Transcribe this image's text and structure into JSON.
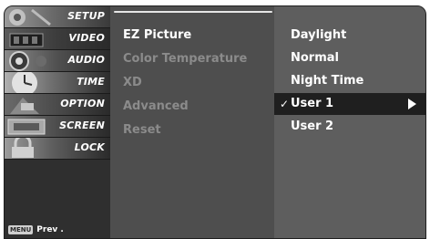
{
  "sidebar": {
    "items": [
      {
        "label": "SETUP",
        "icon": "setup-icon"
      },
      {
        "label": "VIDEO",
        "icon": "video-icon"
      },
      {
        "label": "AUDIO",
        "icon": "audio-icon"
      },
      {
        "label": "TIME",
        "icon": "time-icon"
      },
      {
        "label": "OPTION",
        "icon": "option-icon"
      },
      {
        "label": "SCREEN",
        "icon": "screen-icon"
      },
      {
        "label": "LOCK",
        "icon": "lock-icon"
      }
    ],
    "menu_key_badge": "MENU",
    "menu_key_label": "Prev ."
  },
  "video_menu": {
    "items": [
      {
        "label": "EZ Picture"
      },
      {
        "label": "Color Temperature"
      },
      {
        "label": "XD"
      },
      {
        "label": "Advanced"
      },
      {
        "label": "Reset"
      }
    ]
  },
  "ez_picture_submenu": {
    "items": [
      {
        "label": "Daylight"
      },
      {
        "label": "Normal"
      },
      {
        "label": "Night Time"
      },
      {
        "label": "User 1"
      },
      {
        "label": "User 2"
      }
    ],
    "check_mark": "✓"
  },
  "colors": {
    "panel_dark": "#2f2f2f",
    "panel_mid": "#4e4e4e",
    "panel_light": "#5e5e5e",
    "selection": "#1f1f1f",
    "text_active": "#ffffff",
    "text_disabled": "#8b8b8b"
  }
}
